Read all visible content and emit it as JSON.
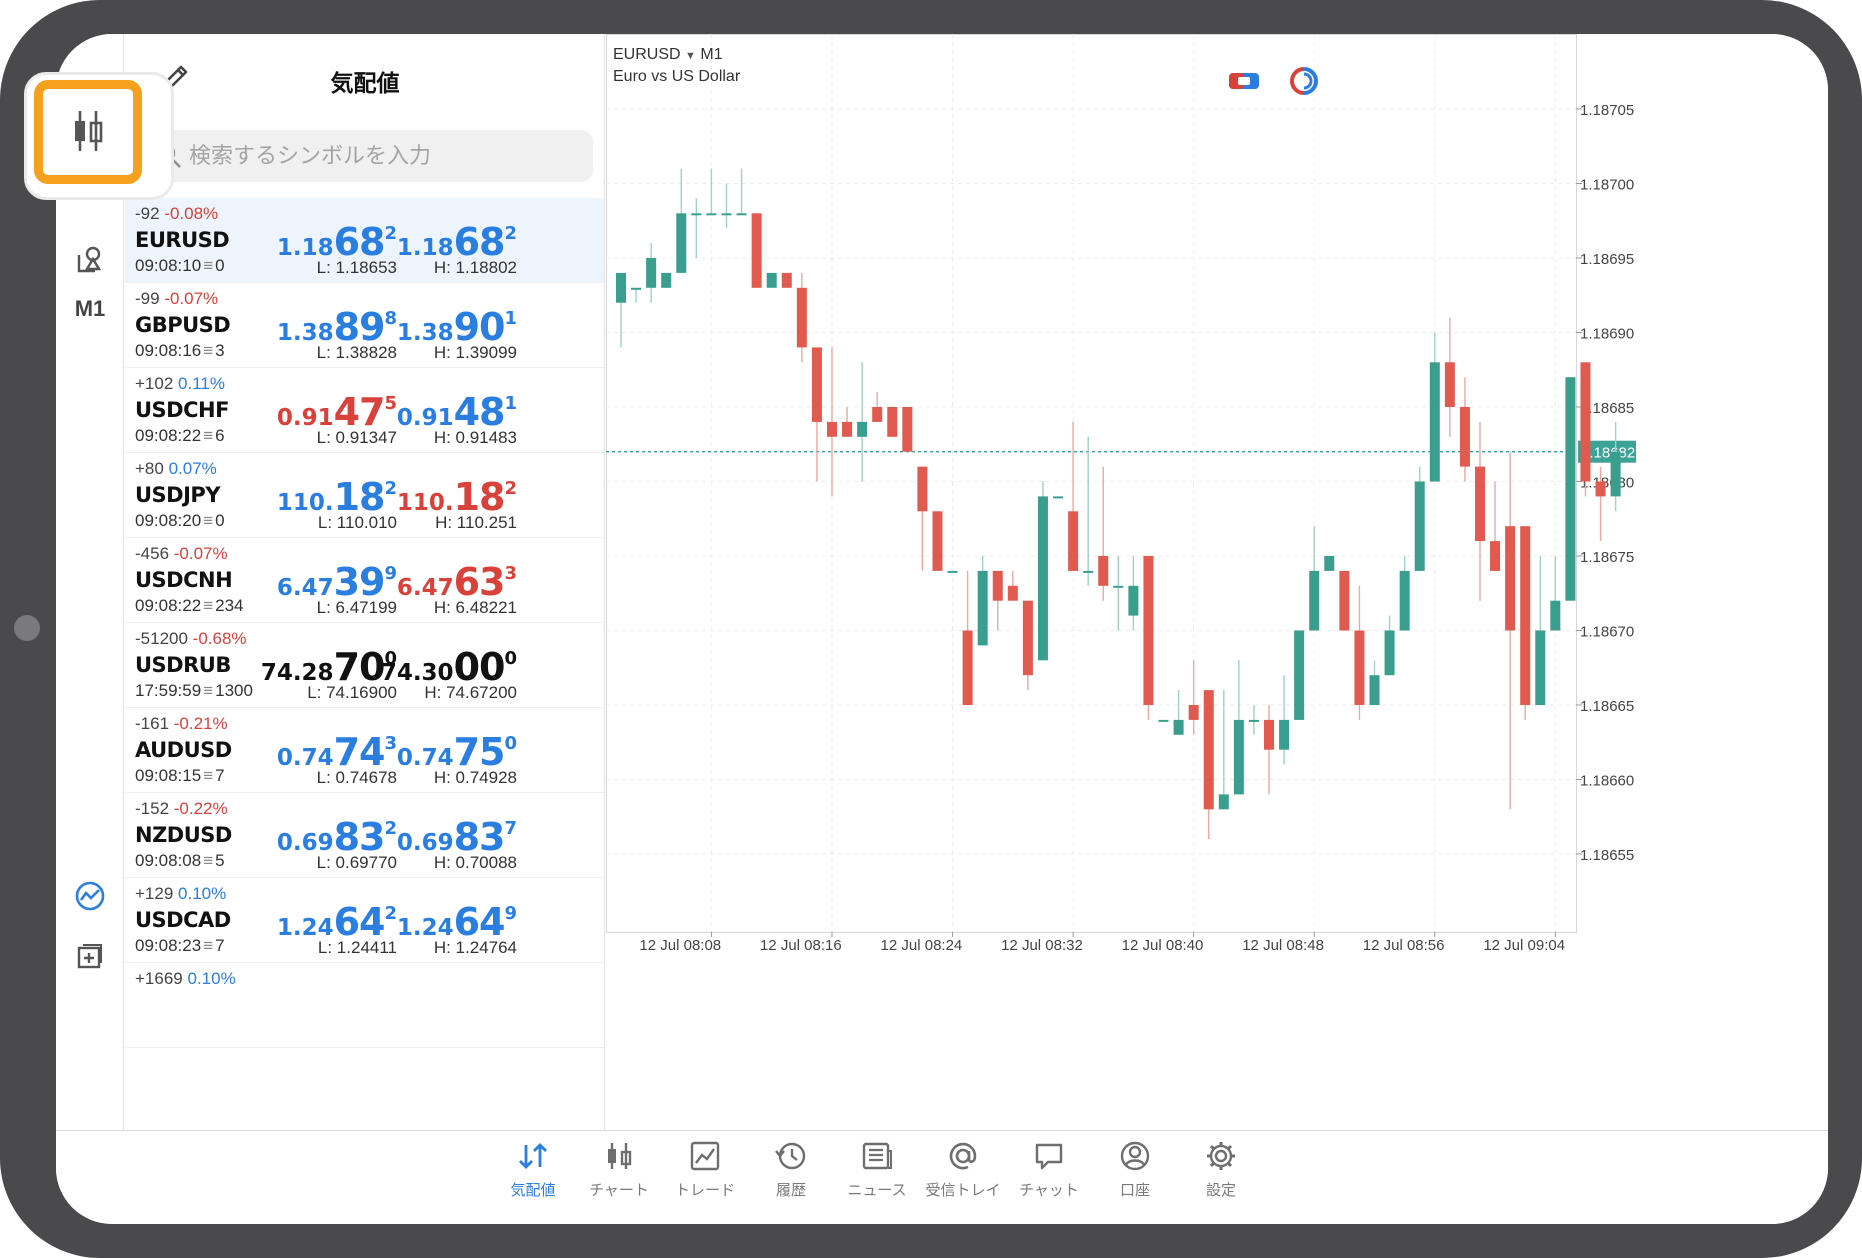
{
  "toolbar": {
    "timeframe": "M1"
  },
  "watchlist": {
    "title": "気配値",
    "search_placeholder": "検索するシンボルを入力",
    "rows": [
      {
        "change": "-92",
        "pct": "-0.08%",
        "pct_dir": "neg",
        "symbol": "EURUSD",
        "time": "09:08:10",
        "spread": "0",
        "bid": {
          "small": "1.18",
          "big": "68",
          "sup": "2",
          "color": "blue"
        },
        "ask": {
          "small": "1.18",
          "big": "68",
          "sup": "2",
          "color": "blue"
        },
        "low": "L: 1.18653",
        "high": "H: 1.18802",
        "selected": true
      },
      {
        "change": "-99",
        "pct": "-0.07%",
        "pct_dir": "neg",
        "symbol": "GBPUSD",
        "time": "09:08:16",
        "spread": "3",
        "bid": {
          "small": "1.38",
          "big": "89",
          "sup": "8",
          "color": "blue"
        },
        "ask": {
          "small": "1.38",
          "big": "90",
          "sup": "1",
          "color": "blue"
        },
        "low": "L: 1.38828",
        "high": "H: 1.39099"
      },
      {
        "change": "+102",
        "pct": "0.11%",
        "pct_dir": "pos",
        "symbol": "USDCHF",
        "time": "09:08:22",
        "spread": "6",
        "bid": {
          "small": "0.91",
          "big": "47",
          "sup": "5",
          "color": "red"
        },
        "ask": {
          "small": "0.91",
          "big": "48",
          "sup": "1",
          "color": "blue"
        },
        "low": "L: 0.91347",
        "high": "H: 0.91483"
      },
      {
        "change": "+80",
        "pct": "0.07%",
        "pct_dir": "pos",
        "symbol": "USDJPY",
        "time": "09:08:20",
        "spread": "0",
        "bid": {
          "small": "110.",
          "big": "18",
          "sup": "2",
          "color": "blue"
        },
        "ask": {
          "small": "110.",
          "big": "18",
          "sup": "2",
          "color": "red"
        },
        "low": "L: 110.010",
        "high": "H: 110.251"
      },
      {
        "change": "-456",
        "pct": "-0.07%",
        "pct_dir": "neg",
        "symbol": "USDCNH",
        "time": "09:08:22",
        "spread": "234",
        "bid": {
          "small": "6.47",
          "big": "39",
          "sup": "9",
          "color": "blue"
        },
        "ask": {
          "small": "6.47",
          "big": "63",
          "sup": "3",
          "color": "red"
        },
        "low": "L: 6.47199",
        "high": "H: 6.48221"
      },
      {
        "change": "-51200",
        "pct": "-0.68%",
        "pct_dir": "neg",
        "symbol": "USDRUB",
        "time": "17:59:59",
        "spread": "1300",
        "bid": {
          "small": "74.28",
          "big": "70",
          "sup": "0",
          "color": "black"
        },
        "ask": {
          "small": "74.30",
          "big": "00",
          "sup": "0",
          "color": "black"
        },
        "low": "L: 74.16900",
        "high": "H: 74.67200"
      },
      {
        "change": "-161",
        "pct": "-0.21%",
        "pct_dir": "neg",
        "symbol": "AUDUSD",
        "time": "09:08:15",
        "spread": "7",
        "bid": {
          "small": "0.74",
          "big": "74",
          "sup": "3",
          "color": "blue"
        },
        "ask": {
          "small": "0.74",
          "big": "75",
          "sup": "0",
          "color": "blue"
        },
        "low": "L: 0.74678",
        "high": "H: 0.74928"
      },
      {
        "change": "-152",
        "pct": "-0.22%",
        "pct_dir": "neg",
        "symbol": "NZDUSD",
        "time": "09:08:08",
        "spread": "5",
        "bid": {
          "small": "0.69",
          "big": "83",
          "sup": "2",
          "color": "blue"
        },
        "ask": {
          "small": "0.69",
          "big": "83",
          "sup": "7",
          "color": "blue"
        },
        "low": "L: 0.69770",
        "high": "H: 0.70088"
      },
      {
        "change": "+129",
        "pct": "0.10%",
        "pct_dir": "pos",
        "symbol": "USDCAD",
        "time": "09:08:23",
        "spread": "7",
        "bid": {
          "small": "1.24",
          "big": "64",
          "sup": "2",
          "color": "blue"
        },
        "ask": {
          "small": "1.24",
          "big": "64",
          "sup": "9",
          "color": "blue"
        },
        "low": "L: 1.24411",
        "high": "H: 1.24764"
      },
      {
        "change": "+1669",
        "pct": "0.10%",
        "pct_dir": "pos",
        "symbol": "",
        "time": "",
        "spread": "",
        "bid": {
          "small": "",
          "big": "",
          "sup": "",
          "color": "blue"
        },
        "ask": {
          "small": "",
          "big": "",
          "sup": "",
          "color": "blue"
        },
        "low": "",
        "high": "",
        "partial": true
      }
    ]
  },
  "chart": {
    "symbol": "EURUSD",
    "timeframe": "M1",
    "description": "Euro vs US Dollar",
    "current_price": "1.18682"
  },
  "chart_data": {
    "type": "candlestick",
    "y_ticks": [
      "1.18705",
      "1.18700",
      "1.18695",
      "1.18690",
      "1.18685",
      "1.18680",
      "1.18675",
      "1.18670",
      "1.18665",
      "1.18660",
      "1.18655"
    ],
    "x_ticks": [
      "12 Jul 08:08",
      "12 Jul 08:16",
      "12 Jul 08:24",
      "12 Jul 08:32",
      "12 Jul 08:40",
      "12 Jul 08:48",
      "12 Jul 08:56",
      "12 Jul 09:04"
    ],
    "ylim": [
      1.18651,
      1.18711
    ],
    "current": 1.18682,
    "candles": [
      [
        1.18692,
        1.18694,
        1.18693,
        1.18689
      ],
      [
        1.18693,
        1.18693,
        1.18693,
        1.18692
      ],
      [
        1.18693,
        1.18695,
        1.18696,
        1.18692
      ],
      [
        1.18693,
        1.18694,
        1.18694,
        1.18693
      ],
      [
        1.18694,
        1.18698,
        1.18701,
        1.18694
      ],
      [
        1.18698,
        1.18698,
        1.18699,
        1.18695
      ],
      [
        1.18698,
        1.18698,
        1.18701,
        1.18698
      ],
      [
        1.18698,
        1.18698,
        1.187,
        1.18697
      ],
      [
        1.18698,
        1.18698,
        1.18701,
        1.18698
      ],
      [
        1.18698,
        1.18693,
        1.18698,
        1.18693
      ],
      [
        1.18693,
        1.18694,
        1.18694,
        1.18693
      ],
      [
        1.18694,
        1.18693,
        1.18694,
        1.18693
      ],
      [
        1.18693,
        1.18689,
        1.18694,
        1.18688
      ],
      [
        1.18689,
        1.18684,
        1.18689,
        1.1868
      ],
      [
        1.18684,
        1.18683,
        1.18689,
        1.18679
      ],
      [
        1.18684,
        1.18683,
        1.18685,
        1.18683
      ],
      [
        1.18683,
        1.18684,
        1.18688,
        1.1868
      ],
      [
        1.18685,
        1.18684,
        1.18686,
        1.18684
      ],
      [
        1.18685,
        1.18683,
        1.18685,
        1.18683
      ],
      [
        1.18685,
        1.18682,
        1.18685,
        1.18682
      ],
      [
        1.18681,
        1.18678,
        1.18681,
        1.18674
      ],
      [
        1.18678,
        1.18674,
        1.18678,
        1.18674
      ],
      [
        1.18674,
        1.18674,
        1.18674,
        1.18674
      ],
      [
        1.1867,
        1.18665,
        1.18674,
        1.18665
      ],
      [
        1.18669,
        1.18674,
        1.18675,
        1.18669
      ],
      [
        1.18674,
        1.18672,
        1.18674,
        1.1867
      ],
      [
        1.18673,
        1.18672,
        1.18674,
        1.18672
      ],
      [
        1.18672,
        1.18667,
        1.18672,
        1.18666
      ],
      [
        1.18668,
        1.18679,
        1.1868,
        1.18668
      ],
      [
        1.18679,
        1.18679,
        1.18679,
        1.18679
      ],
      [
        1.18678,
        1.18674,
        1.18684,
        1.18674
      ],
      [
        1.18674,
        1.18674,
        1.18683,
        1.18673
      ],
      [
        1.18675,
        1.18673,
        1.18681,
        1.18672
      ],
      [
        1.18673,
        1.18673,
        1.18675,
        1.1867
      ],
      [
        1.18671,
        1.18673,
        1.18675,
        1.1867
      ],
      [
        1.18675,
        1.18665,
        1.18675,
        1.18664
      ],
      [
        1.18664,
        1.18664,
        1.18664,
        1.18664
      ],
      [
        1.18663,
        1.18664,
        1.18666,
        1.18663
      ],
      [
        1.18665,
        1.18664,
        1.18668,
        1.18663
      ],
      [
        1.18666,
        1.18658,
        1.18666,
        1.18656
      ],
      [
        1.18658,
        1.18659,
        1.18666,
        1.18658
      ],
      [
        1.18659,
        1.18664,
        1.18668,
        1.18659
      ],
      [
        1.18664,
        1.18664,
        1.18665,
        1.18663
      ],
      [
        1.18664,
        1.18662,
        1.18665,
        1.18659
      ],
      [
        1.18662,
        1.18664,
        1.18667,
        1.18661
      ],
      [
        1.18664,
        1.1867,
        1.1867,
        1.18664
      ],
      [
        1.1867,
        1.18674,
        1.18677,
        1.1867
      ],
      [
        1.18674,
        1.18675,
        1.18675,
        1.18674
      ],
      [
        1.18674,
        1.1867,
        1.18674,
        1.1867
      ],
      [
        1.1867,
        1.18665,
        1.18673,
        1.18664
      ],
      [
        1.18665,
        1.18667,
        1.18668,
        1.18665
      ],
      [
        1.18667,
        1.1867,
        1.18671,
        1.18667
      ],
      [
        1.1867,
        1.18674,
        1.18675,
        1.1867
      ],
      [
        1.18674,
        1.1868,
        1.18681,
        1.18674
      ],
      [
        1.1868,
        1.18688,
        1.1869,
        1.1868
      ],
      [
        1.18688,
        1.18685,
        1.18691,
        1.18683
      ],
      [
        1.18685,
        1.18681,
        1.18687,
        1.1868
      ],
      [
        1.18681,
        1.18676,
        1.18684,
        1.18672
      ],
      [
        1.18676,
        1.18674,
        1.1868,
        1.18674
      ],
      [
        1.18677,
        1.1867,
        1.18682,
        1.18658
      ],
      [
        1.18677,
        1.18665,
        1.18677,
        1.18664
      ],
      [
        1.18665,
        1.1867,
        1.18675,
        1.18665
      ],
      [
        1.1867,
        1.18672,
        1.18675,
        1.1867
      ],
      [
        1.18672,
        1.18687,
        1.18687,
        1.18672
      ],
      [
        1.18688,
        1.1868,
        1.18688,
        1.18679
      ],
      [
        1.1868,
        1.18679,
        1.18681,
        1.18676
      ],
      [
        1.18679,
        1.18682,
        1.18684,
        1.18678
      ]
    ]
  }
}
